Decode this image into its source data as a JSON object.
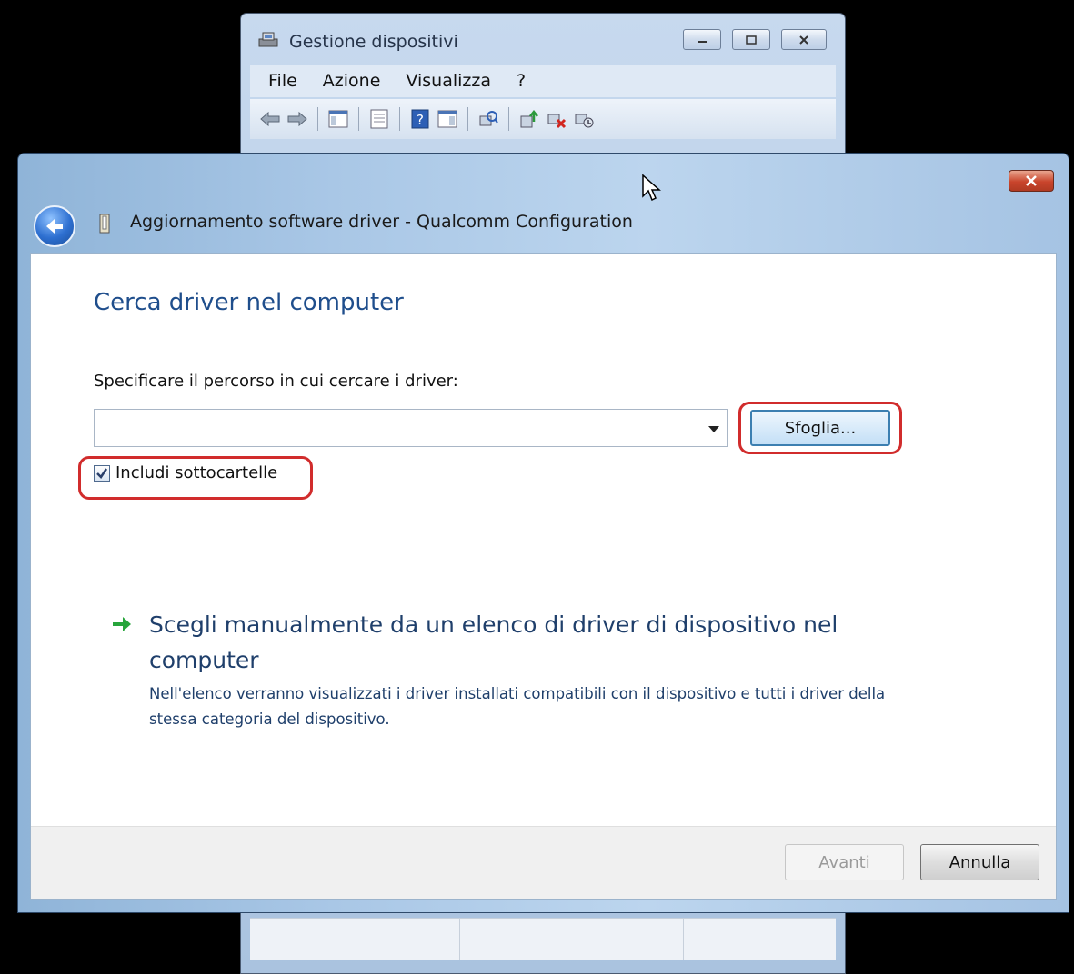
{
  "background_window": {
    "title": "Gestione dispositivi",
    "menu": [
      "File",
      "Azione",
      "Visualizza",
      "?"
    ],
    "toolbar_icons": [
      "back-arrow-icon",
      "forward-arrow-icon",
      "show-hide-console-tree-icon",
      "properties-icon",
      "help-icon",
      "action-pane-icon",
      "scan-hardware-icon",
      "update-driver-icon",
      "uninstall-icon",
      "enable-device-icon"
    ]
  },
  "dialog": {
    "title": "Aggiornamento software driver - Qualcomm Configuration",
    "heading": "Cerca driver nel computer",
    "path_label": "Specificare il percorso in cui cercare i driver:",
    "path_value": "",
    "browse_label": "Sfoglia...",
    "include_subfolders_label": "Includi sottocartelle",
    "include_subfolders_checked": true,
    "option_title": "Scegli manualmente da un elenco di driver di dispositivo nel computer",
    "option_description": "Nell'elenco verranno visualizzati i driver installati compatibili con il dispositivo e tutti i driver della stessa categoria del dispositivo.",
    "next_label": "Avanti",
    "cancel_label": "Annulla",
    "highlight_color": "#d12c2c"
  }
}
